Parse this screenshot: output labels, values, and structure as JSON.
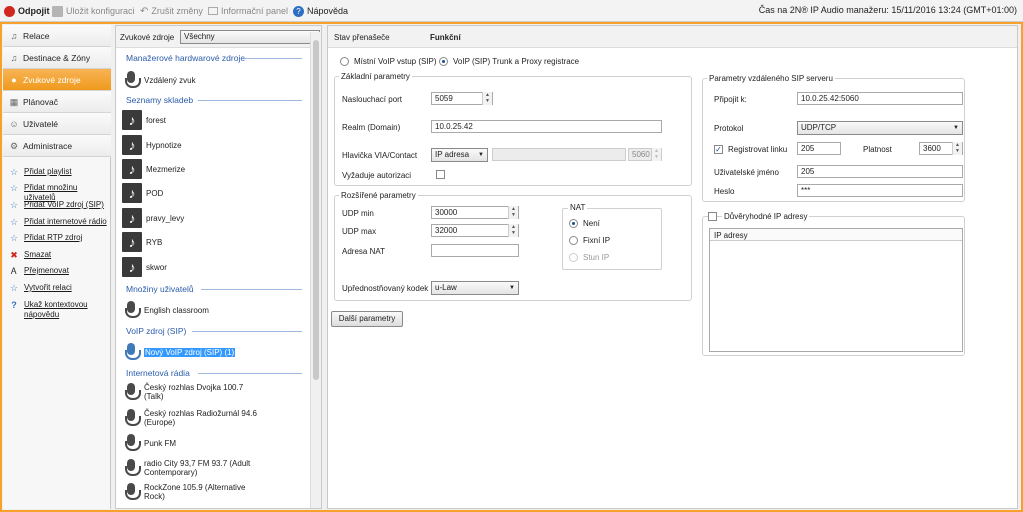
{
  "toolbar": {
    "disconnect": "Odpojit",
    "save_config": "Uložit konfiguraci",
    "undo": "Zrušit změny",
    "info_panel": "Informační panel",
    "help": "Nápověda",
    "status": "Čas na 2N® IP Audio manažeru: 15/11/2016 13:24 (GMT+01:00)"
  },
  "nav": {
    "items": [
      {
        "label": "Relace",
        "icon": "note-icon"
      },
      {
        "label": "Destinace & Zóny",
        "icon": "speaker-icon"
      },
      {
        "label": "Zvukové zdroje",
        "icon": "bulb-icon"
      },
      {
        "label": "Plánovač",
        "icon": "calendar-icon"
      },
      {
        "label": "Uživatelé",
        "icon": "users-icon"
      },
      {
        "label": "Administrace",
        "icon": "gear-icon"
      }
    ],
    "actions": [
      {
        "label": "Přidat playlist",
        "icon": "star-icon"
      },
      {
        "label": "Přidat množinu uživatelů",
        "icon": "star-icon"
      },
      {
        "label": "Přidat VoIP zdroj (SIP)",
        "icon": "star-icon"
      },
      {
        "label": "Přidat internetové rádio",
        "icon": "star-icon"
      },
      {
        "label": "Přidat RTP zdroj",
        "icon": "star-icon"
      },
      {
        "label": "Smazat",
        "icon": "delete-icon"
      },
      {
        "label": "Přejmenovat",
        "icon": "rename-icon"
      },
      {
        "label": "Vytvořit relaci",
        "icon": "star-icon"
      },
      {
        "label": "Ukaž kontextovou",
        "label2": "nápovědu",
        "icon": "help-icon"
      }
    ]
  },
  "sources": {
    "filter_label": "Zvukové zdroje",
    "filter_value": "Všechny",
    "groups": {
      "hw": "Manažerové hardwarové zdroje",
      "playlists": "Seznamy skladeb",
      "users": "Množiny uživatelů",
      "voip": "VoIP zdroj (SIP)",
      "radio": "Internetová rádia"
    },
    "hw_items": [
      "Vzdálený zvuk"
    ],
    "playlists": [
      "forest",
      "Hypnotize",
      "Mezmerize",
      "POD",
      "pravy_levy",
      "RYB",
      "skwor"
    ],
    "users": [
      "English classroom"
    ],
    "voip": [
      "Nový VoIP zdroj (SIP) (1)"
    ],
    "radio": [
      {
        "l1": "Český rozhlas Dvojka 100.7",
        "l2": "(Talk)"
      },
      {
        "l1": "Český rozhlas Radiožurnál 94.6",
        "l2": "(Europe)"
      },
      {
        "l1": "Punk FM",
        "l2": ""
      },
      {
        "l1": "radio City 93,7 FM 93.7 (Adult",
        "l2": "Contemporary)"
      },
      {
        "l1": "RockZone 105.9 (Alternative",
        "l2": "Rock)"
      }
    ]
  },
  "detail": {
    "state_label": "Stav přenašeče",
    "state_value": "Funkční",
    "mode_local": "Místní VoIP vstup (SIP)",
    "mode_trunk": "VoIP (SIP) Trunk a Proxy registrace",
    "basic": {
      "title": "Základní parametry",
      "port_label": "Naslouchací port",
      "port_value": "5059",
      "realm_label": "Realm (Domain)",
      "realm_value": "10.0.25.42",
      "via_label": "Hlavička VIA/Contact",
      "via_select": "IP adresa",
      "via_port": "5060",
      "auth_label": "Vyžaduje autorizaci"
    },
    "advanced": {
      "title": "Rozšířené parametry",
      "udp_min_label": "UDP min",
      "udp_min": "30000",
      "udp_max_label": "UDP max",
      "udp_max": "32000",
      "nat_addr_label": "Adresa NAT",
      "nat_title": "NAT",
      "nat_none": "Není",
      "nat_fixed": "Fixní IP",
      "nat_stun": "Stun IP",
      "codec_label": "Upřednostňovaný kodek",
      "codec_value": "u-Law"
    },
    "more_button": "Další parametry",
    "remote": {
      "title": "Parametry vzdáleného SIP serveru",
      "connect_label": "Připojit k:",
      "connect_value": "10.0.25.42:5060",
      "protocol_label": "Protokol",
      "protocol_value": "UDP/TCP",
      "register_label": "Registrovat linku",
      "register_value": "205",
      "validity_label": "Platnost",
      "validity_value": "3600",
      "user_label": "Uživatelské jméno",
      "user_value": "205",
      "password_label": "Heslo",
      "password_value": "***"
    },
    "trusted": {
      "title": "Důvěryhodné IP adresy",
      "column": "IP adresy"
    }
  },
  "colors": {
    "accent": "#f6a12a",
    "group_text": "#2a5caa",
    "selection": "#3399ff"
  }
}
